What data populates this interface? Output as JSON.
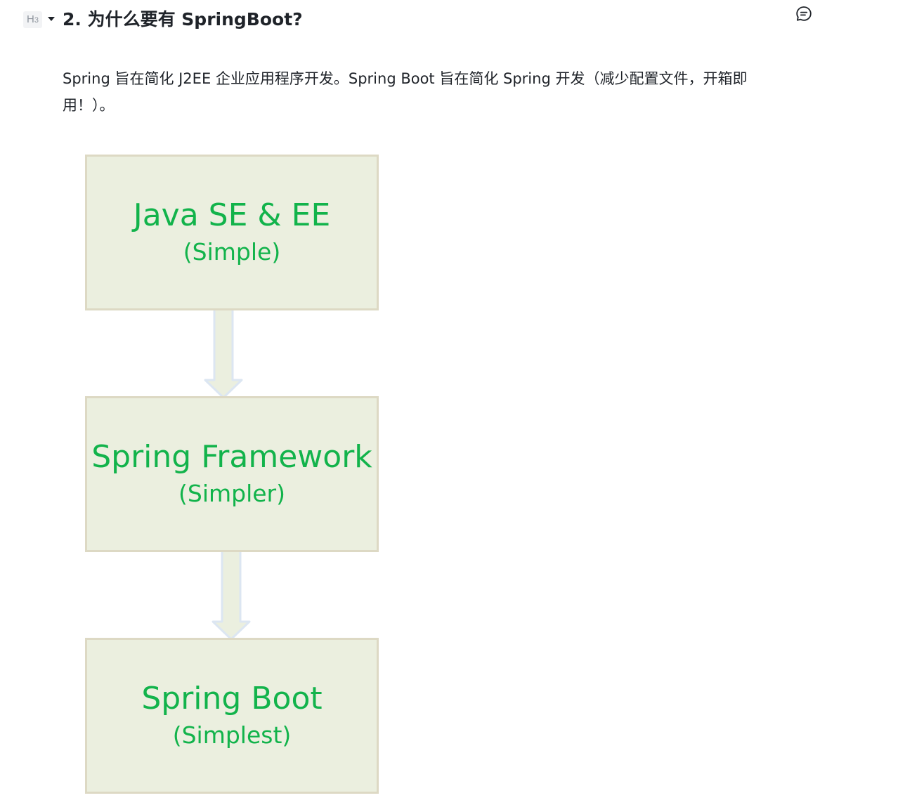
{
  "heading": {
    "level_badge": "H3",
    "title": "2. 为什么要有 SpringBoot?"
  },
  "icons": {
    "fold_toggle": "caret-down-icon",
    "comment": "comment-icon"
  },
  "intro_text": "Spring 旨在简化 J2EE 企业应用程序开发。Spring Boot 旨在简化 Spring 开发（减少配置文件，开箱即用！）。",
  "diagram": {
    "boxes": [
      {
        "title": "Java SE & EE",
        "subtitle": "(Simple)"
      },
      {
        "title": "Spring Framework",
        "subtitle": "(Simpler)"
      },
      {
        "title": "Spring Boot",
        "subtitle": "(Simplest)"
      }
    ]
  },
  "colors": {
    "text_green": "#12b34b",
    "box_fill": "#ebefdf",
    "box_border": "#ddd9c4",
    "arrow_fill": "#ebefdf",
    "arrow_stroke": "#dce6f2"
  }
}
